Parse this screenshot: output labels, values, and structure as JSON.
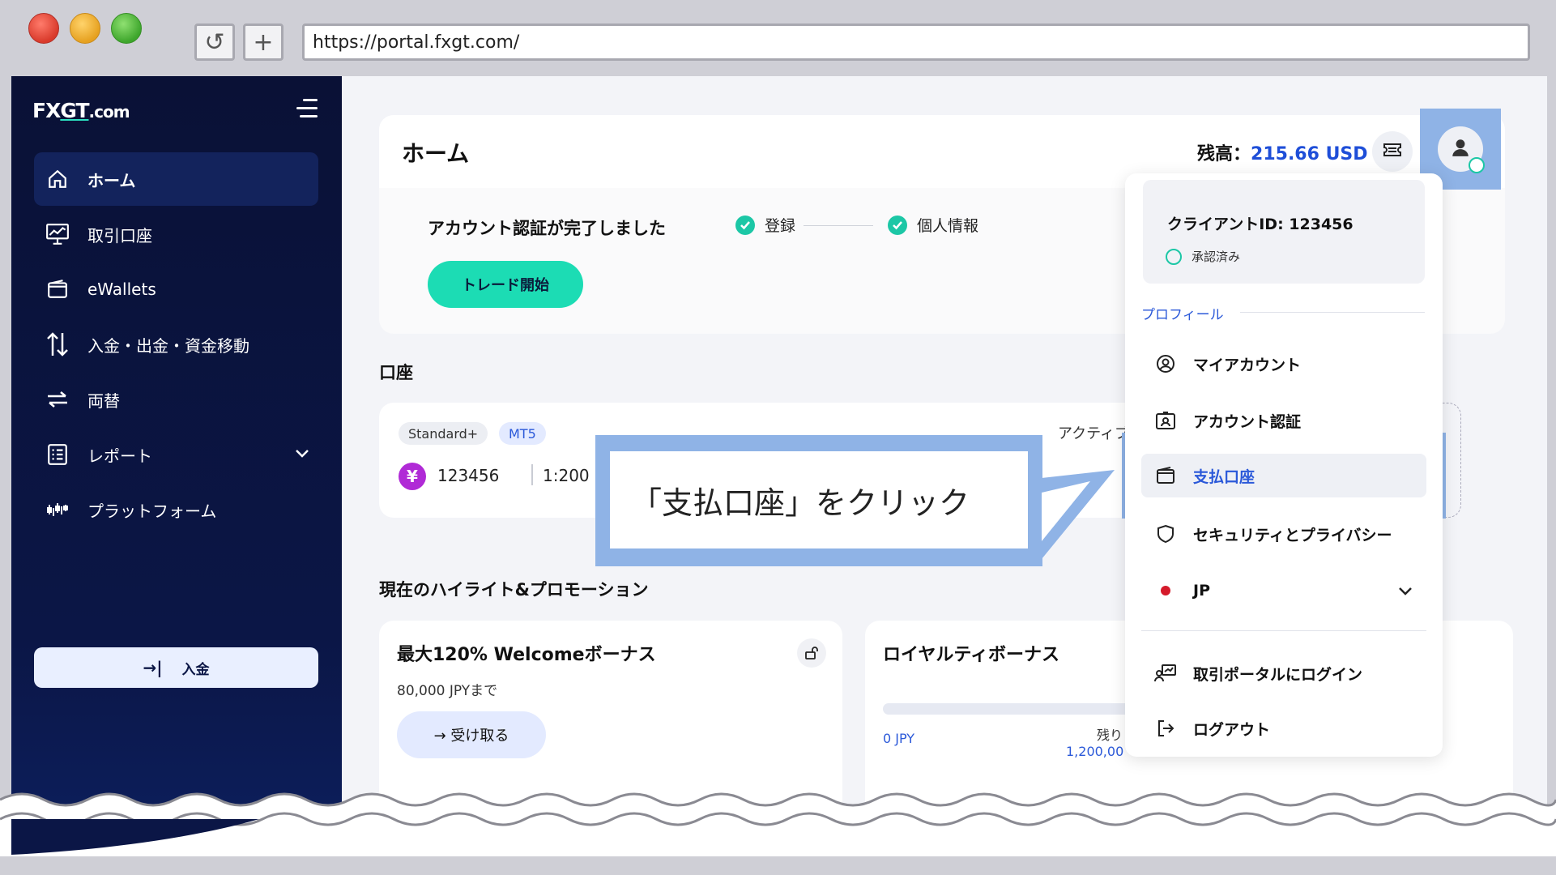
{
  "browser": {
    "url": "https://portal.fxgt.com/",
    "reload_glyph": "↺",
    "plus_glyph": "+"
  },
  "sidebar": {
    "logo_fx": "FX",
    "logo_gt": "GT",
    "logo_com": ".com",
    "items": [
      {
        "label": "ホーム",
        "icon": "home-icon",
        "active": true
      },
      {
        "label": "取引口座",
        "icon": "chart-monitor-icon"
      },
      {
        "label": "eWallets",
        "icon": "wallet-icon"
      },
      {
        "label": "入金・出金・資金移動",
        "icon": "transfer-arrows-icon"
      },
      {
        "label": "両替",
        "icon": "exchange-icon"
      },
      {
        "label": "レポート",
        "icon": "report-list-icon",
        "has_chevron": true
      },
      {
        "label": "プラットフォーム",
        "icon": "platform-icon"
      }
    ],
    "deposit_label": "入金",
    "deposit_arrow": "→|"
  },
  "header": {
    "title": "ホーム",
    "balance_label": "残高：",
    "balance_amount": "215.66 USD"
  },
  "verification": {
    "title": "アカウント認証が完了しました",
    "trade_button": "トレード開始",
    "steps": [
      "登録",
      "個人情報"
    ]
  },
  "accounts": {
    "section_title": "口座",
    "type_pill": "Standard+",
    "platform_pill": "MT5",
    "currency_symbol": "¥",
    "account_number": "123456",
    "leverage": "1:200",
    "status_partial": "アクティブ"
  },
  "promotions": {
    "section_title": "現在のハイライト&プロモーション",
    "welcome": {
      "title": "最大120% Welcomeボーナス",
      "subtitle": "80,000 JPYまで",
      "button": "→ 受け取る"
    },
    "loyalty": {
      "title": "ロイヤルティボーナス",
      "current": "0 JPY",
      "remaining_label": "残り",
      "remaining_value": "1,200,00"
    }
  },
  "dropdown": {
    "client_id": "クライアントID: 123456",
    "approved": "承認済み",
    "profile_label": "プロフィール",
    "items": [
      {
        "label": "マイアカウント",
        "icon": "user-circle-icon"
      },
      {
        "label": "アカウント認証",
        "icon": "id-card-icon"
      },
      {
        "label": "支払口座",
        "icon": "wallet-icon",
        "selected": true
      },
      {
        "label": "セキュリティとプライバシー",
        "icon": "shield-icon"
      },
      {
        "label": "JP",
        "icon": "japan-flag-icon",
        "has_chevron": true
      },
      {
        "label": "取引ポータルにログイン",
        "icon": "portal-login-icon"
      },
      {
        "label": "ログアウト",
        "icon": "logout-icon"
      }
    ]
  },
  "callout": {
    "text": "「支払口座」をクリック"
  },
  "colors": {
    "sidebar_bg": "#0a1136",
    "accent_blue": "#2b59d9",
    "accent_teal": "#1cdcb4",
    "highlight": "#8fb3e6"
  }
}
